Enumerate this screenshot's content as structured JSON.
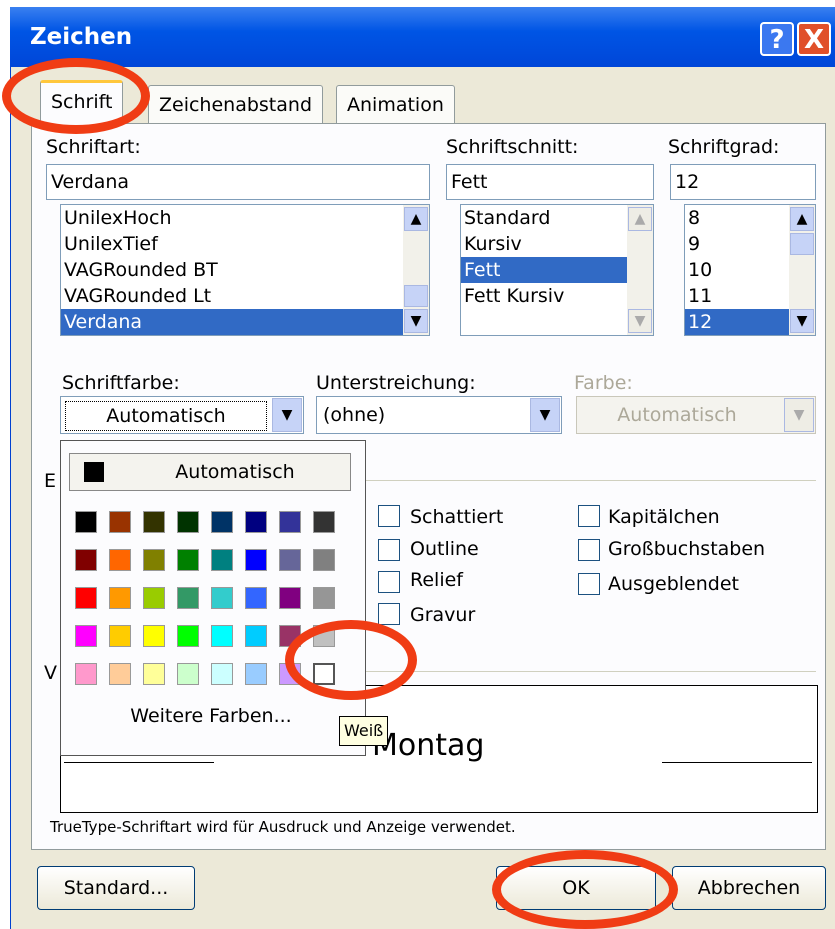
{
  "window": {
    "title": "Zeichen",
    "help_glyph": "?",
    "close_glyph": "X"
  },
  "tabs": [
    {
      "label": "Schrift"
    },
    {
      "label": "Zeichenabstand"
    },
    {
      "label": "Animation"
    }
  ],
  "font": {
    "label": "Schriftart:",
    "value": "Verdana",
    "items": [
      "UnilexHoch",
      "UnilexTief",
      "VAGRounded BT",
      "VAGRounded Lt",
      "Verdana"
    ],
    "selected_index": 4
  },
  "style": {
    "label": "Schriftschnitt:",
    "value": "Fett",
    "items": [
      "Standard",
      "Kursiv",
      "Fett",
      "Fett Kursiv"
    ],
    "selected_index": 2
  },
  "size": {
    "label": "Schriftgrad:",
    "value": "12",
    "items": [
      "8",
      "9",
      "10",
      "11",
      "12"
    ],
    "selected_index": 4
  },
  "font_color": {
    "label": "Schriftfarbe:",
    "value": "Automatisch"
  },
  "underline": {
    "label": "Unterstreichung:",
    "value": "(ohne)"
  },
  "underline_color": {
    "label": "Farbe:",
    "value": "Automatisch"
  },
  "effects": {
    "clipped_label": "E",
    "col1": [
      "Schattiert",
      "Outline",
      "Relief",
      "Gravur"
    ],
    "col2": [
      "Kapitälchen",
      "Großbuchstaben",
      "Ausgeblendet"
    ]
  },
  "preview": {
    "clipped_label": "V",
    "text": "Montag"
  },
  "info_text": "TrueType-Schriftart wird für Ausdruck und Anzeige verwendet.",
  "buttons": {
    "default": "Standard...",
    "ok": "OK",
    "cancel": "Abbrechen"
  },
  "color_popup": {
    "auto_label": "Automatisch",
    "more_label": "Weitere Farben...",
    "tooltip": "Weiß",
    "colors": [
      [
        "#000000",
        "#993300",
        "#333300",
        "#003300",
        "#003366",
        "#000080",
        "#333399",
        "#333333"
      ],
      [
        "#800000",
        "#ff6600",
        "#808000",
        "#008000",
        "#008080",
        "#0000ff",
        "#666699",
        "#808080"
      ],
      [
        "#ff0000",
        "#ff9900",
        "#99cc00",
        "#339966",
        "#33cccc",
        "#3366ff",
        "#800080",
        "#969696"
      ],
      [
        "#ff00ff",
        "#ffcc00",
        "#ffff00",
        "#00ff00",
        "#00ffff",
        "#00ccff",
        "#993366",
        "#c0c0c0"
      ],
      [
        "#ff99cc",
        "#ffcc99",
        "#ffff99",
        "#ccffcc",
        "#ccffff",
        "#99ccff",
        "#cc99ff",
        "#ffffff"
      ]
    ]
  },
  "accent": {
    "title_bar": "#0055e5",
    "selection": "#316ac5",
    "highlight_circle": "#f03c14"
  }
}
